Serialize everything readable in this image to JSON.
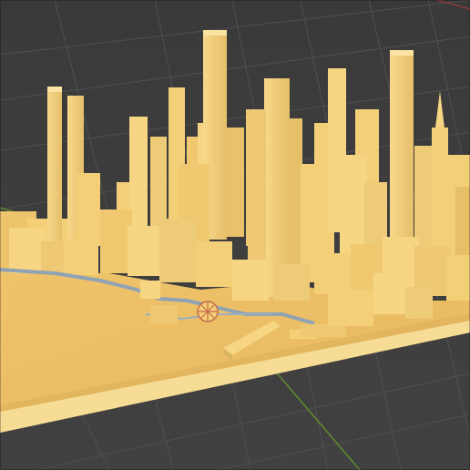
{
  "viewport": {
    "view": "3D Viewport",
    "shading": "solid",
    "background_color": "#3d3d3d",
    "grid_line_color": "#4e4e4e",
    "x_axis_color": "#8f3a3a",
    "y_axis_color": "#5f8b2f"
  },
  "scene": {
    "object": "city-model",
    "material_color": "#f3cf78",
    "material_shadow_color": "#d9b45c",
    "waterfront_path_color": "#8fa3b4",
    "road_marker_color": "#c66a4a",
    "icons": {
      "road_junction": "compass-rose-icon"
    }
  }
}
